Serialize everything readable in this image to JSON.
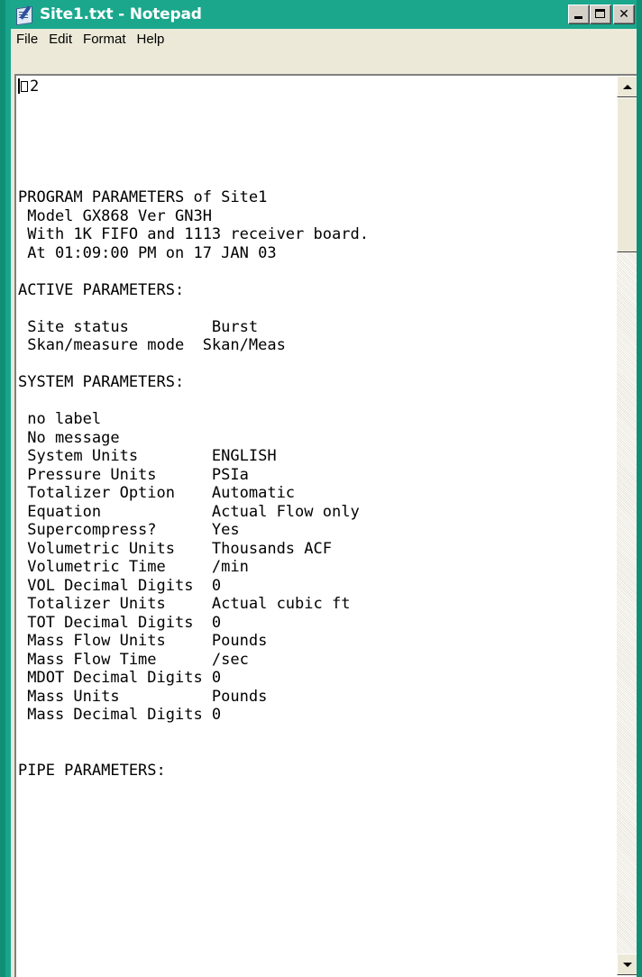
{
  "window": {
    "title": "Site1.txt - Notepad",
    "theme_color": "#1aa78c",
    "icon": "notepad-icon"
  },
  "caption_buttons": {
    "minimize_icon": "minimize-icon",
    "maximize_icon": "maximize-icon",
    "close_label": "✕",
    "close_icon": "close-icon"
  },
  "menu": {
    "items": [
      "File",
      "Edit",
      "Format",
      "Help"
    ]
  },
  "document": {
    "first_line_text": "2",
    "lines": [
      "",
      "",
      "",
      "",
      "",
      "PROGRAM PARAMETERS of Site1",
      " Model GX868 Ver GN3H",
      " With 1K FIFO and 1113 receiver board.",
      " At 01:09:00 PM on 17 JAN 03",
      "",
      "ACTIVE PARAMETERS:",
      "",
      " Site status         Burst",
      " Skan/measure mode  Skan/Meas",
      "",
      "SYSTEM PARAMETERS:",
      "",
      " no label",
      " No message",
      " System Units        ENGLISH",
      " Pressure Units      PSIa",
      " Totalizer Option    Automatic",
      " Equation            Actual Flow only",
      " Supercompress?      Yes",
      " Volumetric Units    Thousands ACF",
      " Volumetric Time     /min",
      " VOL Decimal Digits  0",
      " Totalizer Units     Actual cubic ft",
      " TOT Decimal Digits  0",
      " Mass Flow Units     Pounds",
      " Mass Flow Time      /sec",
      " MDOT Decimal Digits 0",
      " Mass Units          Pounds",
      " Mass Decimal Digits 0",
      "",
      "",
      "PIPE PARAMETERS:"
    ]
  },
  "scrollbar": {
    "up_icon": "scroll-up-arrow-icon",
    "down_icon": "scroll-down-arrow-icon",
    "position_fraction": 0.0
  }
}
